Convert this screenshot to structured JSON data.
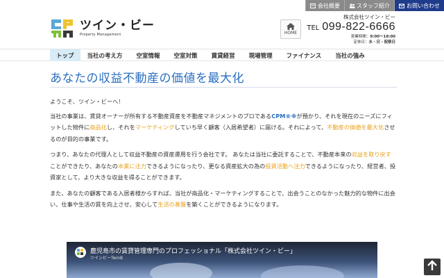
{
  "utility": {
    "overview": "会社概要",
    "staff": "スタッフ紹介",
    "contact": "お問い合わせ"
  },
  "header": {
    "logo_name": "ツイン・ビー",
    "logo_sub": "Property Management",
    "home_label": "HOME",
    "company": "株式会社ツイン・ビー",
    "tel_label": "TEL",
    "tel_number": "099-822-6666",
    "hours_label": "営業時間：",
    "hours_value": "9:00～18:00",
    "holiday_label": "定休日：",
    "holiday_value": "水・日・祝祭日"
  },
  "nav": [
    {
      "label": "トップ"
    },
    {
      "label": "当社の考え方"
    },
    {
      "label": "空室情報"
    },
    {
      "label": "空室対策"
    },
    {
      "label": "賃貸経営"
    },
    {
      "label": "現場管理"
    },
    {
      "label": "ファイナンス"
    },
    {
      "label": "当社の強み"
    }
  ],
  "main": {
    "title": "あなたの収益不動産の価値を最大化",
    "p1": "ようこそ、ツイン・ビーへ！",
    "p2": {
      "a": "当社の事業は、賃貸オーナーが所有する不動産資産を不動産マネジメントのプロである",
      "cpm": "CPM®※",
      "b": "が預かり、それを現在のニーズにフィットした物件に",
      "h1": "商品化",
      "c": "し、それを",
      "h2": "マーケティング",
      "d": "していち早く顧客（入居希望者）に届ける。それによって、",
      "h3": "不動産の価値を最大化",
      "e": "させるのが目的の事業です。"
    },
    "p3": {
      "a": "つまり、あなたの代理人として収益不動産の資産運用を行う会社です。 あなたは当社に委託することで、不動産本来の",
      "h1": "収益を取り戻す",
      "b": "ことができたり、あなたの",
      "h2": "本業に注力",
      "c": "できるようになったり、更なる資産拡大の為の",
      "h3": "投資活動へ注力",
      "d": "できるようになったり、経営者、投資家として、より大きな収益を得ることができます。"
    },
    "p4": {
      "a": "また、あなたの顧客である入居者様からすれば、当社が商品化・マーケティングすることで、出会うことのなかった魅力的な物件に出会い、仕事や生活の質を向上させ、安心して",
      "h1": "生活の基盤",
      "b": "を築くことができるようになります。"
    }
  },
  "video": {
    "title": "鹿児島市の賃貸管理専門のプロフェッショナル「株式会社ツイン・ビー」",
    "channel": "ツインビーTwinB"
  },
  "colors": {
    "accent_blue": "#2a6fc0",
    "highlight_orange": "#e8a21f",
    "contact_navy": "#1f3b8c",
    "nav_active_bg": "#d7ecf7"
  },
  "icons": [
    "building-icon",
    "staff-icon",
    "mail-icon",
    "home-icon",
    "arrow-up-icon"
  ]
}
